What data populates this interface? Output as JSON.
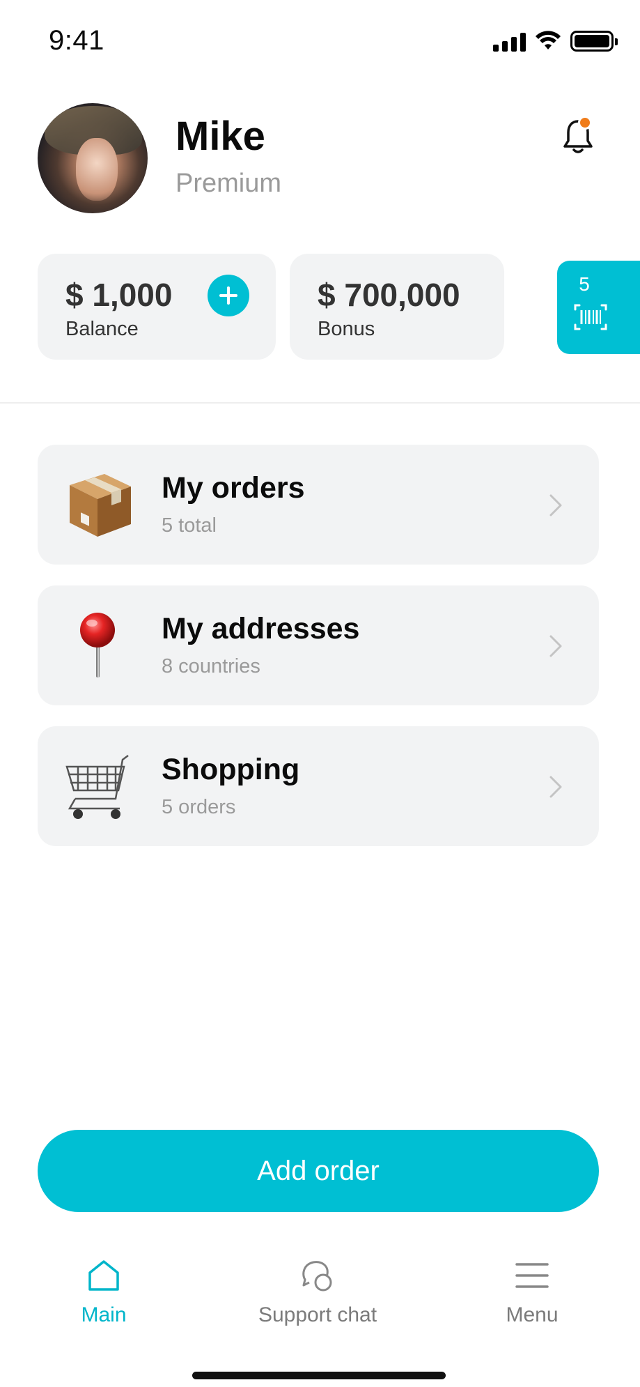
{
  "status_bar": {
    "time": "9:41",
    "icons": [
      "signal-icon",
      "wifi-icon",
      "battery-icon"
    ]
  },
  "profile": {
    "name": "Mike",
    "tier": "Premium",
    "avatar": "avatar-photo",
    "notification_icon": "bell-icon",
    "has_notification": true
  },
  "balances": {
    "balance": {
      "amount": "$ 1,000",
      "label": "Balance",
      "action_icon": "plus-icon"
    },
    "bonus": {
      "amount": "$ 700,000",
      "label": "Bonus"
    },
    "barcode": {
      "count": "5",
      "icon": "barcode-icon"
    }
  },
  "menu_items": [
    {
      "title": "My orders",
      "subtitle": "5 total",
      "icon": "package-icon"
    },
    {
      "title": "My addresses",
      "subtitle": "8 countries",
      "icon": "pushpin-icon"
    },
    {
      "title": "Shopping",
      "subtitle": "5 orders",
      "icon": "shopping-cart-icon"
    }
  ],
  "cta": {
    "label": "Add order"
  },
  "tabs": [
    {
      "label": "Main",
      "icon": "home-icon",
      "active": true
    },
    {
      "label": "Support chat",
      "icon": "chat-icon",
      "active": false
    },
    {
      "label": "Menu",
      "icon": "menu-icon",
      "active": false
    }
  ],
  "colors": {
    "accent": "#00bfd3",
    "notification_dot": "#f07c1a",
    "card_bg": "#f2f3f4",
    "muted_text": "#9a9a9a"
  }
}
